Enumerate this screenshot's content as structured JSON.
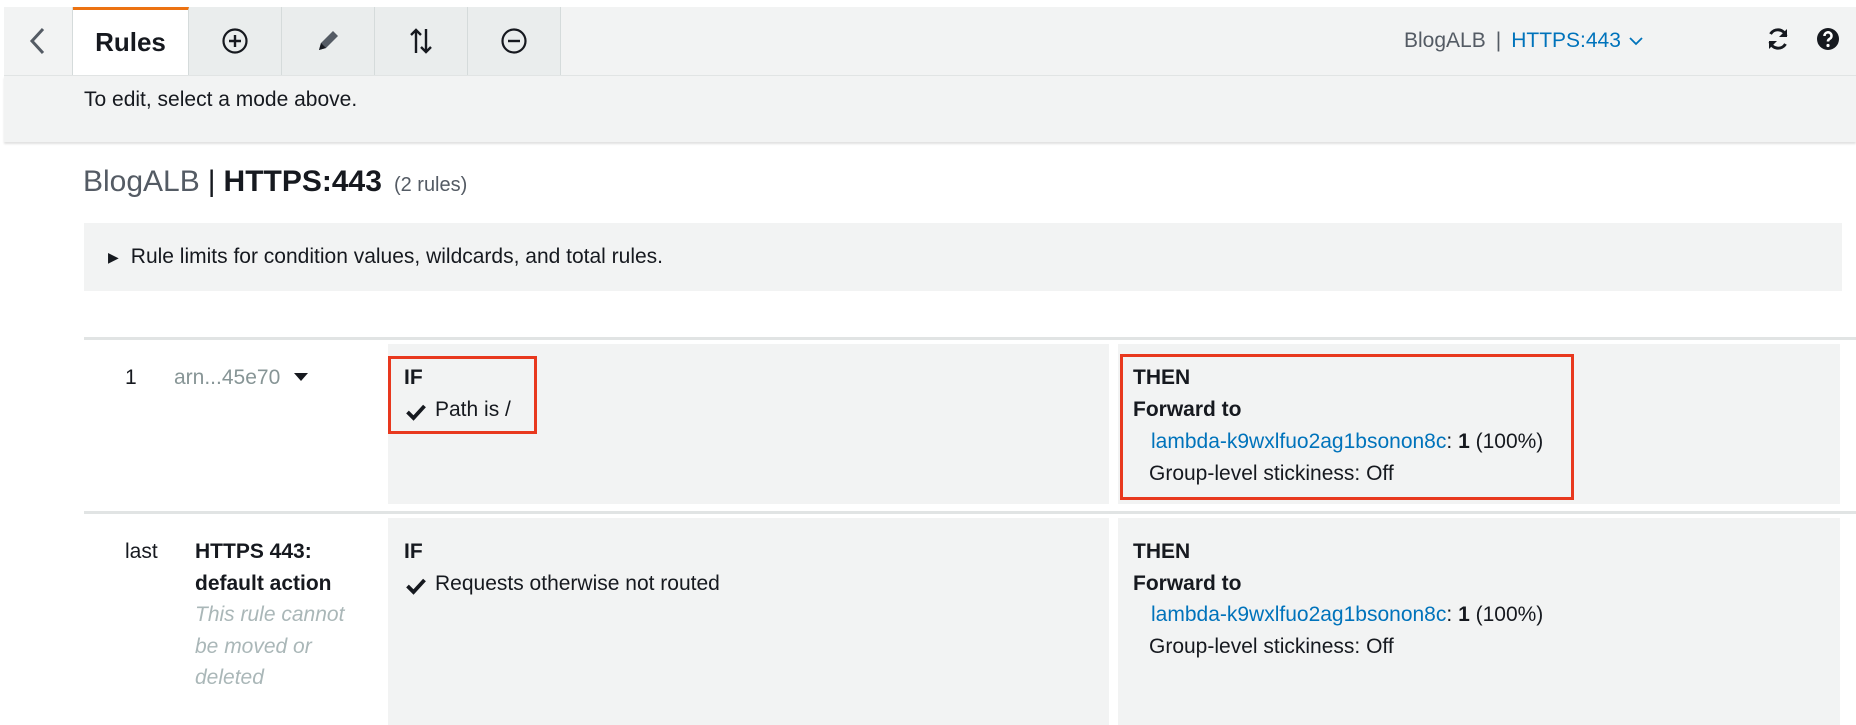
{
  "toolbar": {
    "active_tab": "Rules",
    "context": {
      "lb_name": "BlogALB",
      "separator": "|",
      "listener": "HTTPS:443"
    }
  },
  "edit_hint": "To edit, select a mode above.",
  "page": {
    "lb_name": "BlogALB",
    "separator": "|",
    "listener": "HTTPS:443",
    "rule_count": "(2 rules)"
  },
  "limits_text": "Rule limits for condition values, wildcards, and total rules.",
  "rules": [
    {
      "priority": "1",
      "arn": "arn...45e70",
      "if_label": "IF",
      "condition": "Path is /",
      "then_label": "THEN",
      "action": "Forward to",
      "target": "lambda-k9wxlfuo2ag1bsonon8c",
      "target_sep": ":",
      "weight": "1",
      "weight_pct": "(100%)",
      "stickiness": "Group-level stickiness: Off"
    },
    {
      "priority": "last",
      "name_line1": "HTTPS 443:",
      "name_line2": "default action",
      "note_line1": "This rule cannot",
      "note_line2": "be moved or",
      "note_line3": "deleted",
      "if_label": "IF",
      "condition": "Requests otherwise not routed",
      "then_label": "THEN",
      "action": "Forward to",
      "target": "lambda-k9wxlfuo2ag1bsonon8c",
      "target_sep": ":",
      "weight": "1",
      "weight_pct": "(100%)",
      "stickiness": "Group-level stickiness: Off"
    }
  ],
  "colors": {
    "accent": "#ec7211",
    "link": "#0073bb",
    "highlight": "#e8381e"
  }
}
